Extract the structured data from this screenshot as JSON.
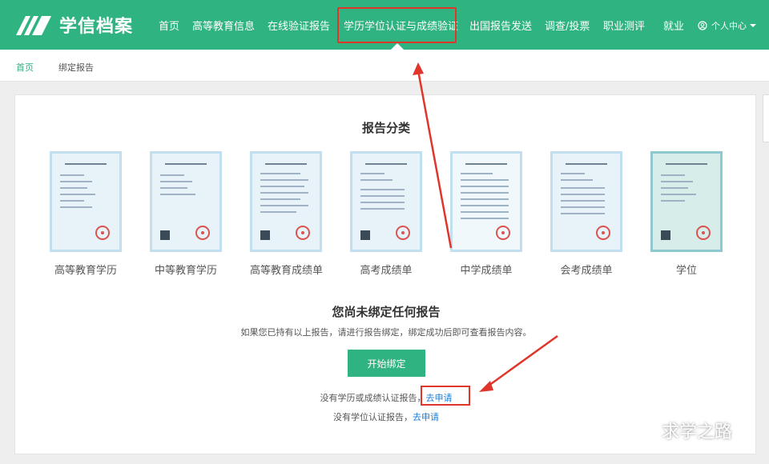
{
  "header": {
    "logo_text": "学信档案",
    "nav": [
      {
        "label": "首页"
      },
      {
        "label": "高等教育信息"
      },
      {
        "label": "在线验证报告"
      },
      {
        "label": "学历学位认证与成绩验证"
      },
      {
        "label": "出国报告发送"
      },
      {
        "label": "调查/投票"
      },
      {
        "label": "职业测评"
      },
      {
        "label": "就业"
      }
    ],
    "user_menu": "个人中心",
    "brand_color": "#2fb381",
    "highlight_color": "#e0352b"
  },
  "breadcrumb": {
    "home": "首页",
    "current": "绑定报告"
  },
  "main": {
    "section_title": "报告分类",
    "reports": [
      {
        "label": "高等教育学历"
      },
      {
        "label": "中等教育学历"
      },
      {
        "label": "高等教育成绩单"
      },
      {
        "label": "高考成绩单"
      },
      {
        "label": "中学成绩单"
      },
      {
        "label": "会考成绩单"
      },
      {
        "label": "学位"
      }
    ],
    "empty_title": "您尚未绑定任何报告",
    "empty_desc": "如果您已持有以上报告，请进行报告绑定，绑定成功后即可查看报告内容。",
    "bind_button": "开始绑定",
    "apply_line1_text": "没有学历或成绩认证报告，",
    "apply_line1_link": "去申请",
    "apply_line2_text": "没有学位认证报告，",
    "apply_line2_link": "去申请"
  },
  "watermark": {
    "text": "求学之路"
  }
}
